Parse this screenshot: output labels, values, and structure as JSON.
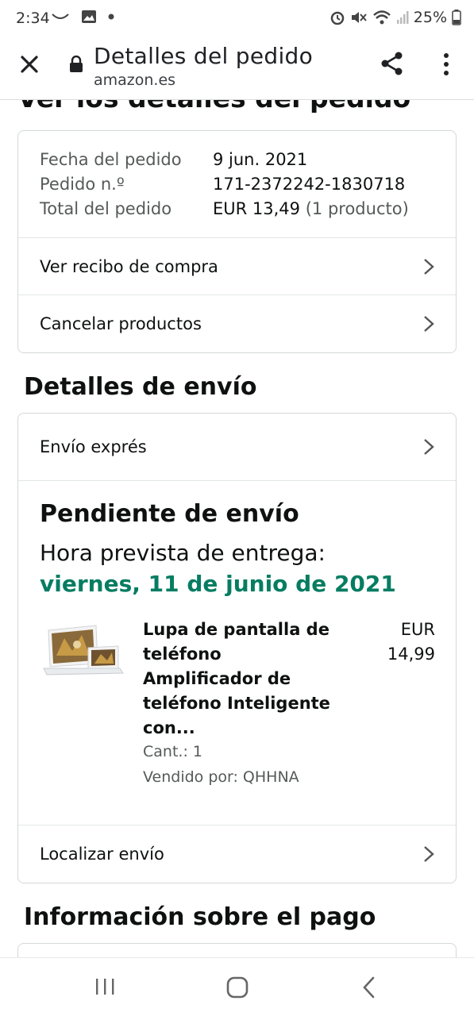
{
  "status_bar": {
    "time": "2:34",
    "battery": "25%",
    "icons": [
      "missed-call-icon",
      "gallery-icon",
      "notification-dot-icon",
      "alarm-icon",
      "mute-icon",
      "wifi-icon",
      "signal-icon",
      "battery-icon"
    ]
  },
  "header": {
    "title": "Detalles del pedido",
    "domain": "amazon.es",
    "icons": [
      "close-icon",
      "lock-icon",
      "share-icon",
      "more-vert-icon"
    ]
  },
  "order": {
    "section_title_cut": "Ver los detalles del pedido",
    "fields": [
      {
        "label": "Fecha del pedido",
        "value": "9 jun. 2021"
      },
      {
        "label": "Pedido n.º",
        "value": "171-2372242-1830718"
      },
      {
        "label": "Total del pedido",
        "value": "EUR 13,49",
        "note": "(1 producto)"
      }
    ],
    "links": [
      "Ver recibo de compra",
      "Cancelar productos"
    ]
  },
  "shipping": {
    "title": "Detalles de envío",
    "method": "Envío exprés",
    "status": "Pendiente de envío",
    "eta_label": "Hora prevista de entrega:",
    "eta_date": "viernes, 11 de junio de 2021",
    "eta_color": "#067d62",
    "item": {
      "name": "Lupa de pantalla de teléfono Amplificador de teléfono Inteligente con...",
      "price": "EUR 14,99",
      "qty": "Cant.: 1",
      "seller": "Vendido por: QHHNA"
    },
    "track_link": "Localizar envío"
  },
  "payment": {
    "title": "Información sobre el pago"
  },
  "nav_bar": {
    "icons": [
      "recent-apps-icon",
      "home-icon",
      "back-icon"
    ]
  }
}
